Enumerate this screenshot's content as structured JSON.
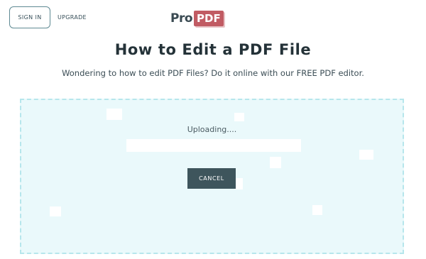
{
  "header": {
    "sign_in_label": "SIGN IN",
    "upgrade_label": "UPGRADE",
    "logo": {
      "brand_text": "Pro",
      "badge_text": "PDF",
      "badge_color": "#c15b63"
    }
  },
  "hero": {
    "title": "How to Edit a PDF File",
    "subtitle": "Wondering to how to edit PDF Files? Do it online with our FREE PDF editor."
  },
  "upload": {
    "status_text": "Uploading....",
    "cancel_label": "CANCEL",
    "progress": 0.0,
    "border_color": "#b6e6ec",
    "background_color": "#eaf9fb"
  },
  "colors": {
    "primary_button": "#3e555c",
    "text": "#2f4048"
  }
}
